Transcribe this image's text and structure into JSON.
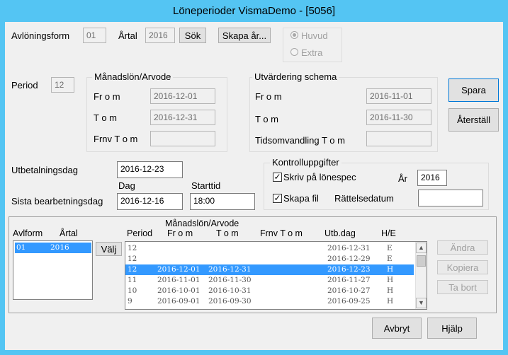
{
  "window": {
    "title": "Löneperioder VismaDemo - [5056]"
  },
  "top": {
    "avloningsform_label": "Avlöningsform",
    "avloningsform_value": "01",
    "artal_label": "Årtal",
    "artal_value": "2016",
    "sok_button": "Sök",
    "skapa_ar_button": "Skapa år...",
    "radio_huvud": "Huvud",
    "radio_extra": "Extra"
  },
  "period": {
    "label": "Period",
    "value": "12"
  },
  "manadslon": {
    "title": "Månadslön/Arvode",
    "from_label": "Fr o m",
    "from_value": "2016-12-01",
    "tom_label": "T o m",
    "tom_value": "2016-12-31",
    "frnv_label": "Frnv T o m",
    "frnv_value": ""
  },
  "utvardering": {
    "title": "Utvärdering schema",
    "from_label": "Fr o m",
    "from_value": "2016-11-01",
    "tom_label": "T o m",
    "tom_value": "2016-11-30",
    "tids_label": "Tidsomvandling T o m",
    "tids_value": ""
  },
  "side_buttons": {
    "spara": "Spara",
    "aterstall": "Återställ"
  },
  "utbetalning": {
    "label": "Utbetalningsdag",
    "value": "2016-12-23",
    "dag_label": "Dag",
    "starttid_label": "Starttid",
    "sista_label": "Sista bearbetningsdag",
    "sista_value": "2016-12-16",
    "starttid_value": "18:00"
  },
  "kontroll": {
    "title": "Kontrolluppgifter",
    "skriv_label": "Skriv på lönespec",
    "skriv_checked": true,
    "ar_label": "År",
    "ar_value": "2016",
    "skapa_fil_label": "Skapa fil",
    "skapa_fil_checked": true,
    "rattelse_label": "Rättelsedatum",
    "rattelse_value": ""
  },
  "bottom": {
    "avlform_header": "Avlform",
    "artal_header": "Årtal",
    "avlform_rows": [
      {
        "avlform": "01",
        "artal": "2016"
      }
    ],
    "valj_button": "Välj",
    "group_header": "Månadslön/Arvode",
    "headers": {
      "period": "Period",
      "from": "Fr o m",
      "tom": "T o m",
      "frnv": "Frnv T o m",
      "utbdag": "Utb.dag",
      "he": "H/E"
    },
    "rows": [
      {
        "period": "12",
        "from": "",
        "tom": "",
        "frnv": "",
        "utbdag": "2016-12-31",
        "he": "E"
      },
      {
        "period": "12",
        "from": "",
        "tom": "",
        "frnv": "",
        "utbdag": "2016-12-29",
        "he": "E"
      },
      {
        "period": "12",
        "from": "2016-12-01",
        "tom": "2016-12-31",
        "frnv": "",
        "utbdag": "2016-12-23",
        "he": "H"
      },
      {
        "period": "11",
        "from": "2016-11-01",
        "tom": "2016-11-30",
        "frnv": "",
        "utbdag": "2016-11-27",
        "he": "H"
      },
      {
        "period": "10",
        "from": "2016-10-01",
        "tom": "2016-10-31",
        "frnv": "",
        "utbdag": "2016-10-27",
        "he": "H"
      },
      {
        "period": "9",
        "from": "2016-09-01",
        "tom": "2016-09-30",
        "frnv": "",
        "utbdag": "2016-09-25",
        "he": "H"
      }
    ],
    "selected_row": 2,
    "andra_button": "Ändra",
    "kopiera_button": "Kopiera",
    "ta_bort_button": "Ta bort"
  },
  "footer": {
    "avbryt": "Avbryt",
    "hjalp": "Hjälp"
  },
  "colors": {
    "titlebar": "#54c5f3",
    "selection": "#3399ff",
    "window_bg": "#f0f0f0"
  }
}
